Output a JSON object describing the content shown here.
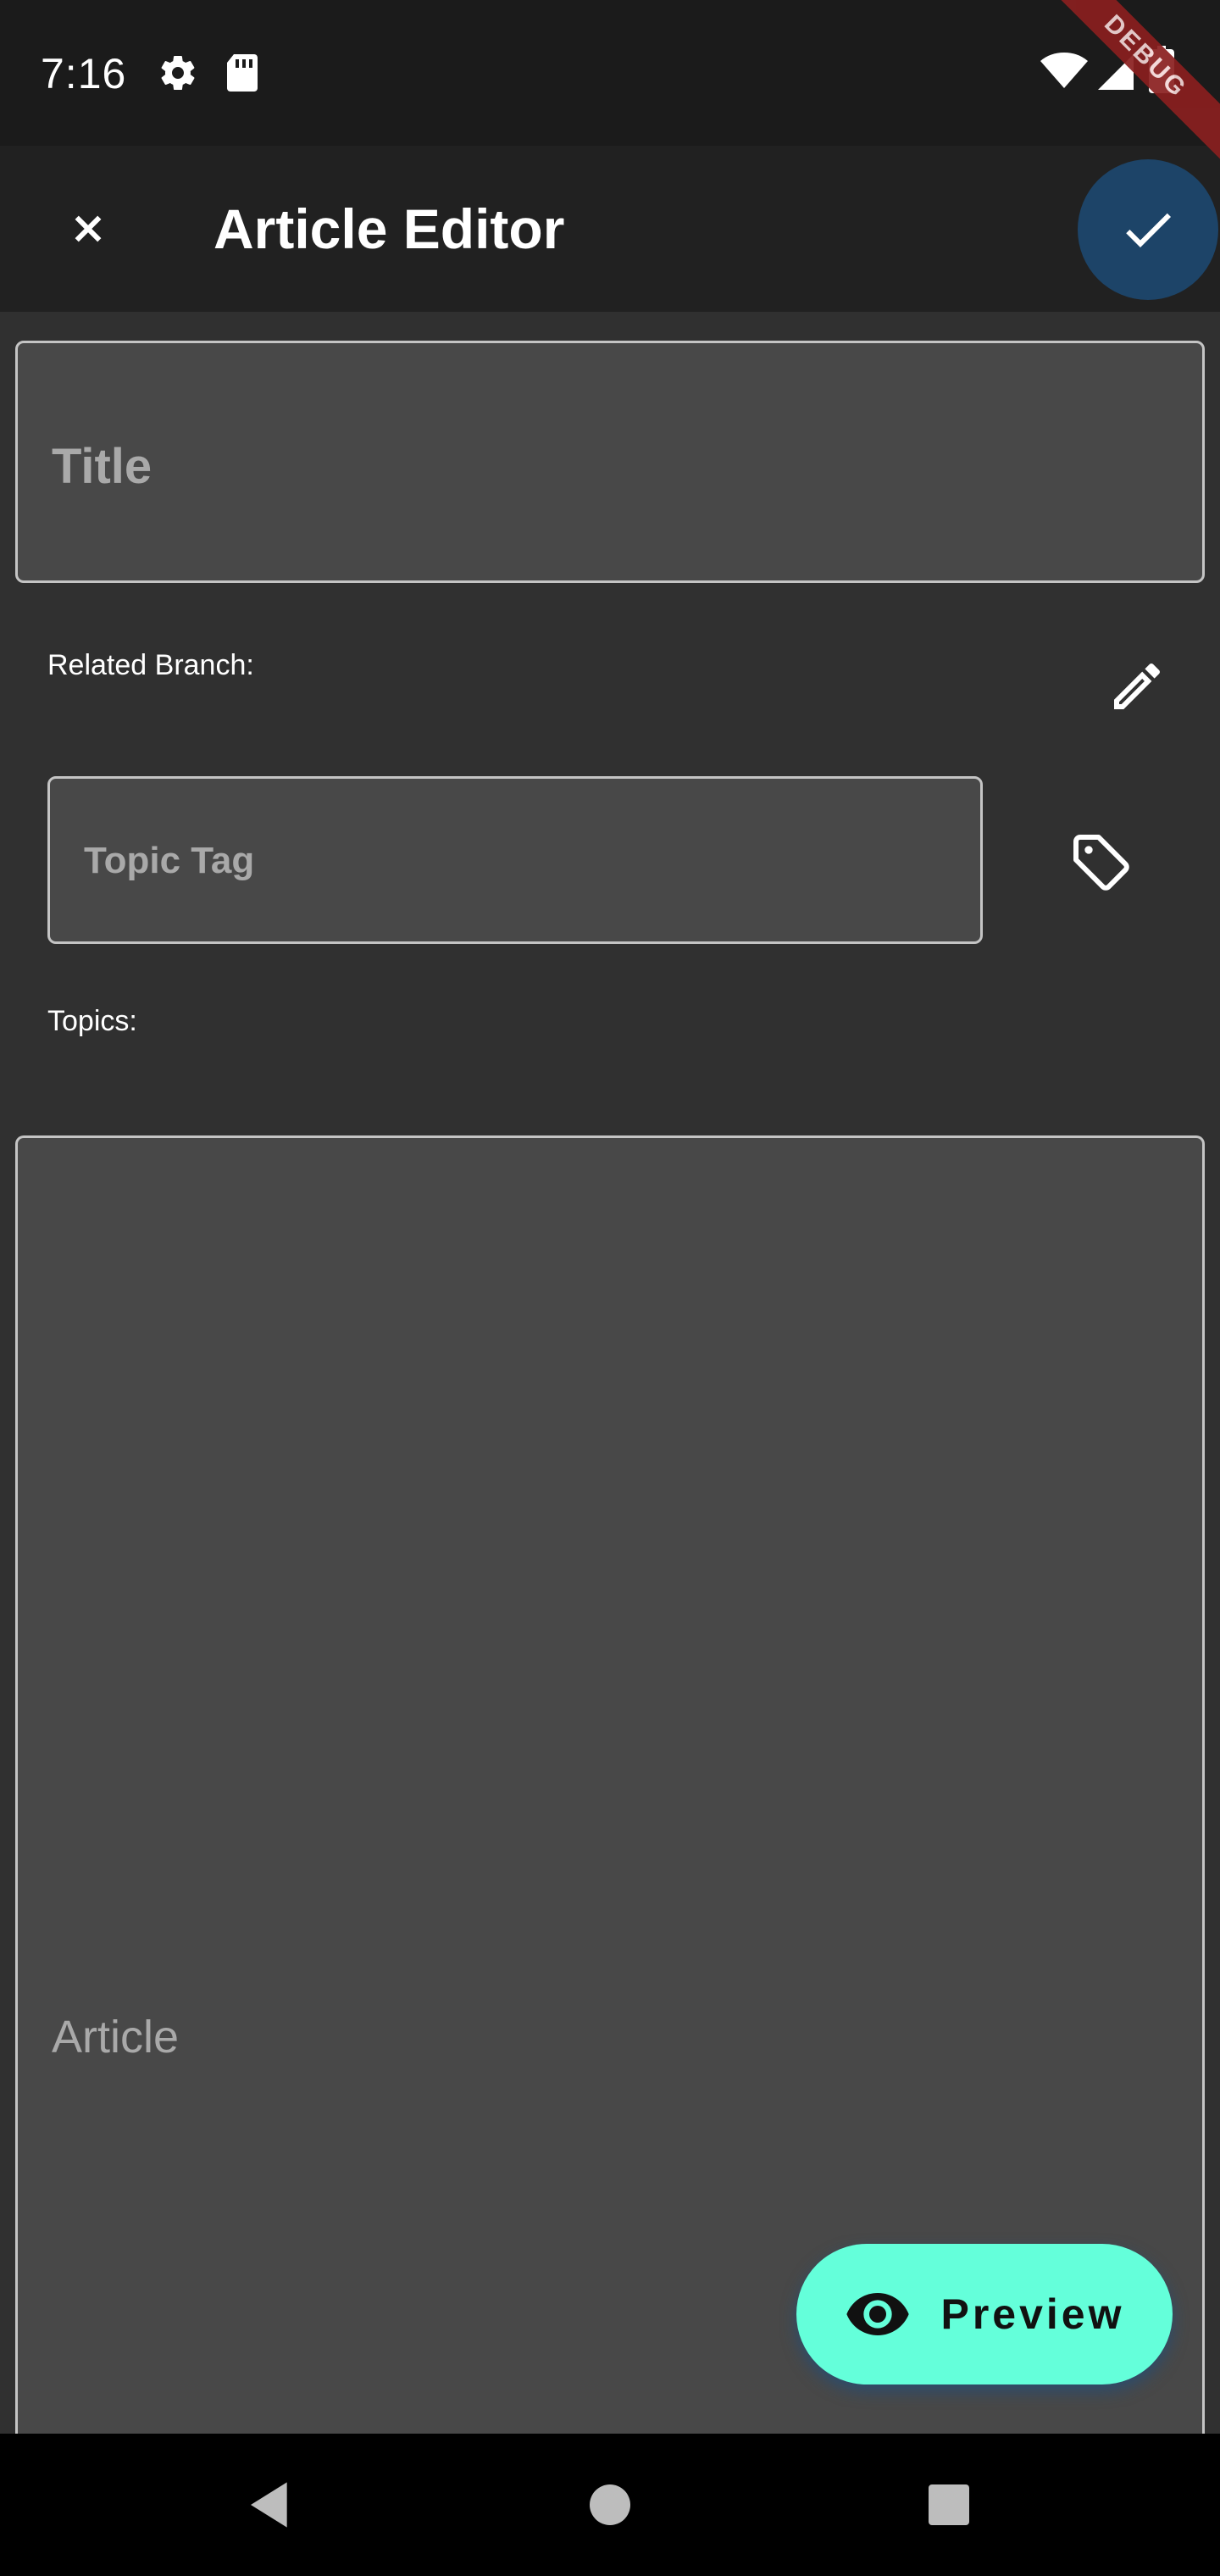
{
  "status_bar": {
    "time": "7:16",
    "icons": [
      "settings-icon",
      "sd-card-icon",
      "wifi-icon",
      "signal-icon",
      "battery-icon"
    ]
  },
  "debug_banner": {
    "label": "DEBUG"
  },
  "app_bar": {
    "title": "Article Editor",
    "close_icon": "close-icon",
    "save_icon": "check-icon"
  },
  "form": {
    "title_placeholder": "Title",
    "related_branch_label": "Related Branch:",
    "topic_tag_placeholder": "Topic Tag",
    "topics_label": "Topics:",
    "article_placeholder": "Article"
  },
  "preview": {
    "label": "Preview",
    "icon": "eye-icon"
  },
  "nav_bar": {
    "icons": [
      "back-icon",
      "home-icon",
      "recents-icon"
    ]
  },
  "colors": {
    "background": "#303030",
    "app_bar": "#212121",
    "status_bar": "#1b1b1b",
    "field": "#484848",
    "accent": "#64ffda",
    "save_circle": "#1d4468"
  }
}
